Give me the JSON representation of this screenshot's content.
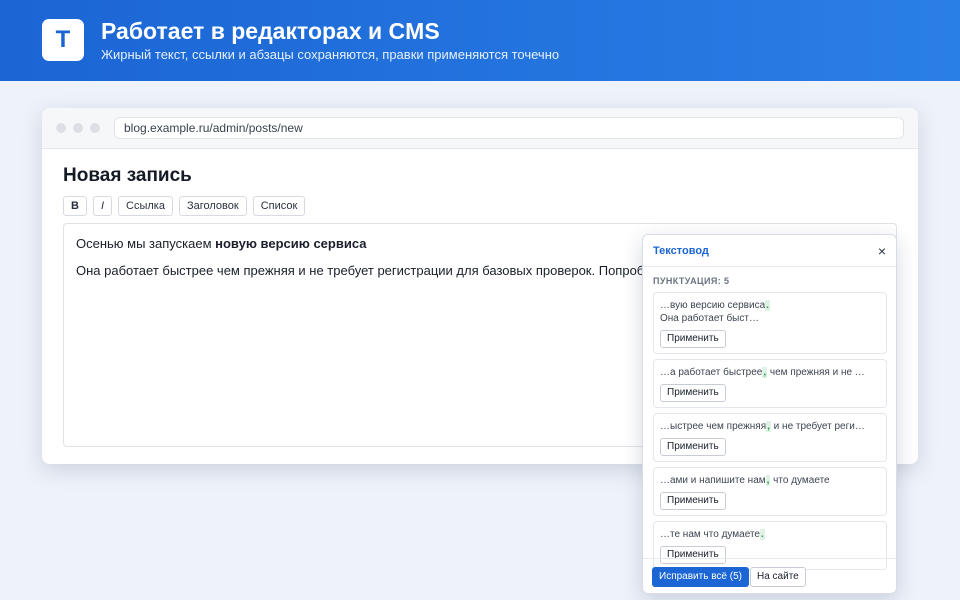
{
  "hero": {
    "logo_letter": "T",
    "title": "Работает в редакторах и CMS",
    "subtitle": "Жирный текст, ссылки и абзацы сохраняются, правки применяются точечно"
  },
  "browser": {
    "url": "blog.example.ru/admin/posts/new"
  },
  "editor": {
    "page_title": "Новая запись",
    "toolbar": [
      "B",
      "I",
      "Ссылка",
      "Заголовок",
      "Список"
    ],
    "paragraph1_text": "Осенью мы запускаем ",
    "paragraph1_bold": "новую версию сервиса",
    "paragraph2": "Она работает быстрее чем прежняя и не требует регистрации для базовых проверок. Попробуй"
  },
  "panel": {
    "title": "Текстовод",
    "close": "×",
    "section": "ПУНКТУАЦИЯ: 5",
    "apply_label": "Применить",
    "suggestions": [
      {
        "before": "…вую версию сервиса",
        "insert": ".",
        "after": "",
        "line2": "Она работает быст…"
      },
      {
        "before": "…а работает быстрее",
        "insert": ",",
        "after": " чем прежняя и не …",
        "line2": ""
      },
      {
        "before": "…ыстрее чем прежняя",
        "insert": ",",
        "after": " и не требует реги…",
        "line2": ""
      },
      {
        "before": "…ами и напишите нам",
        "insert": ",",
        "after": " что думаете",
        "line2": ""
      },
      {
        "before": "…те нам что думаете",
        "insert": ".",
        "after": "",
        "line2": ""
      }
    ],
    "fix_all": "Исправить всё (5)",
    "on_site": "На сайте"
  },
  "colors": {
    "accent": "#1b65d4",
    "highlight_bg": "#dff3e4",
    "highlight_fg": "#2a9a4c"
  }
}
